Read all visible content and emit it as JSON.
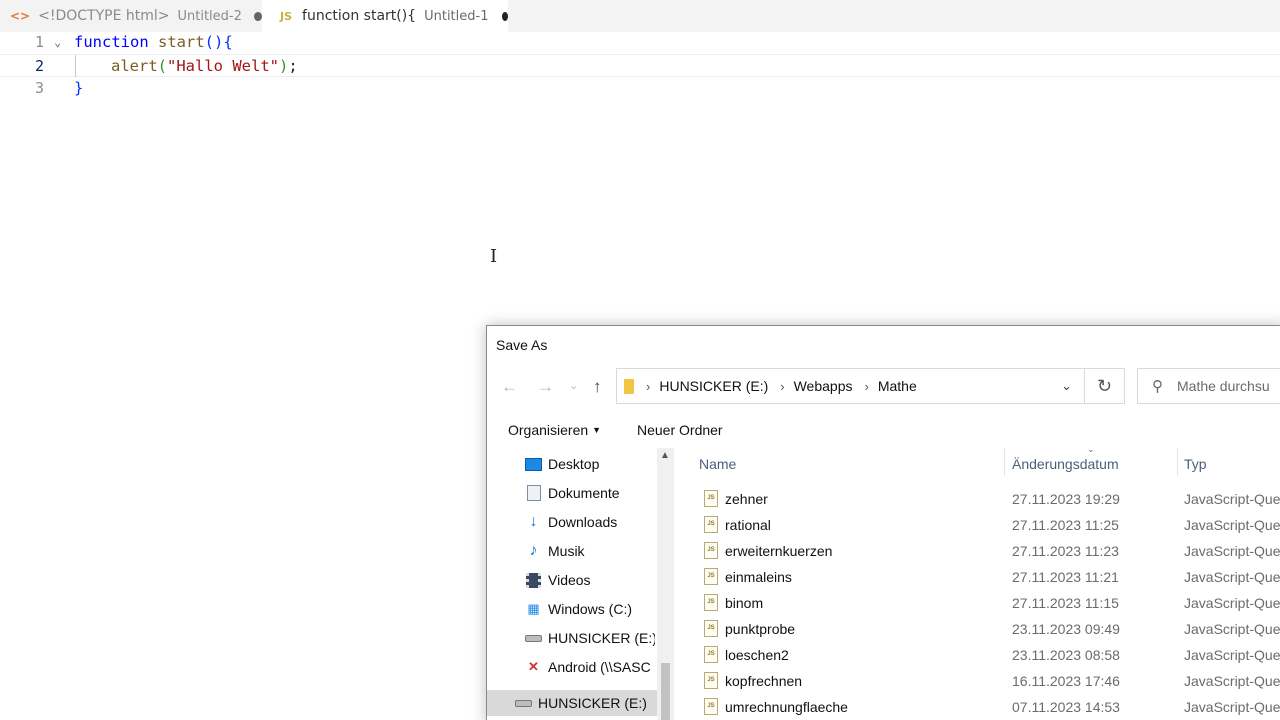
{
  "tabs": [
    {
      "icon": "<>",
      "label": "<!DOCTYPE html>",
      "description": "Untitled-2"
    },
    {
      "icon": "JS",
      "label": "function start(){",
      "description": "Untitled-1"
    }
  ],
  "editor": {
    "lines": [
      {
        "number": "1",
        "t1": "function",
        "t2": " start",
        "t3": "()",
        "t4": "{"
      },
      {
        "number": "2",
        "t1": "alert",
        "t2": "(",
        "t3": "\"Hallo Welt\"",
        "t4": ")",
        "t5": ";"
      },
      {
        "number": "3",
        "t1": "}"
      }
    ]
  },
  "dialog": {
    "title": "Save As",
    "address": {
      "drive": "HUNSICKER (E:)",
      "folder1": "Webapps",
      "folder2": "Mathe"
    },
    "search_placeholder": "Mathe durchsu",
    "organize_label": "Organisieren",
    "new_folder_label": "Neuer Ordner",
    "nav_items": [
      {
        "label": "Desktop",
        "icon": "desktop-icon"
      },
      {
        "label": "Dokumente",
        "icon": "documents-icon"
      },
      {
        "label": "Downloads",
        "icon": "downloads-icon"
      },
      {
        "label": "Musik",
        "icon": "music-icon"
      },
      {
        "label": "Videos",
        "icon": "videos-icon"
      },
      {
        "label": "Windows (C:)",
        "icon": "windows-drive-icon"
      },
      {
        "label": "HUNSICKER (E:)",
        "icon": "drive-icon"
      },
      {
        "label": "Android (\\\\SASC",
        "icon": "network-drive-disconnected-icon"
      },
      {
        "label": "HUNSICKER (E:)",
        "icon": "drive-icon"
      }
    ],
    "columns": {
      "name": "Name",
      "date": "Änderungsdatum",
      "type": "Typ"
    },
    "files": [
      {
        "name": "zehner",
        "date": "27.11.2023 19:29",
        "type": "JavaScript-Que"
      },
      {
        "name": "rational",
        "date": "27.11.2023 11:25",
        "type": "JavaScript-Que"
      },
      {
        "name": "erweiternkuerzen",
        "date": "27.11.2023 11:23",
        "type": "JavaScript-Que"
      },
      {
        "name": "einmaleins",
        "date": "27.11.2023 11:21",
        "type": "JavaScript-Que"
      },
      {
        "name": "binom",
        "date": "27.11.2023 11:15",
        "type": "JavaScript-Que"
      },
      {
        "name": "punktprobe",
        "date": "23.11.2023 09:49",
        "type": "JavaScript-Que"
      },
      {
        "name": "loeschen2",
        "date": "23.11.2023 08:58",
        "type": "JavaScript-Que"
      },
      {
        "name": "kopfrechnen",
        "date": "16.11.2023 17:46",
        "type": "JavaScript-Que"
      },
      {
        "name": "umrechnungflaeche",
        "date": "07.11.2023 14:53",
        "type": "JavaScript-Que"
      }
    ]
  }
}
